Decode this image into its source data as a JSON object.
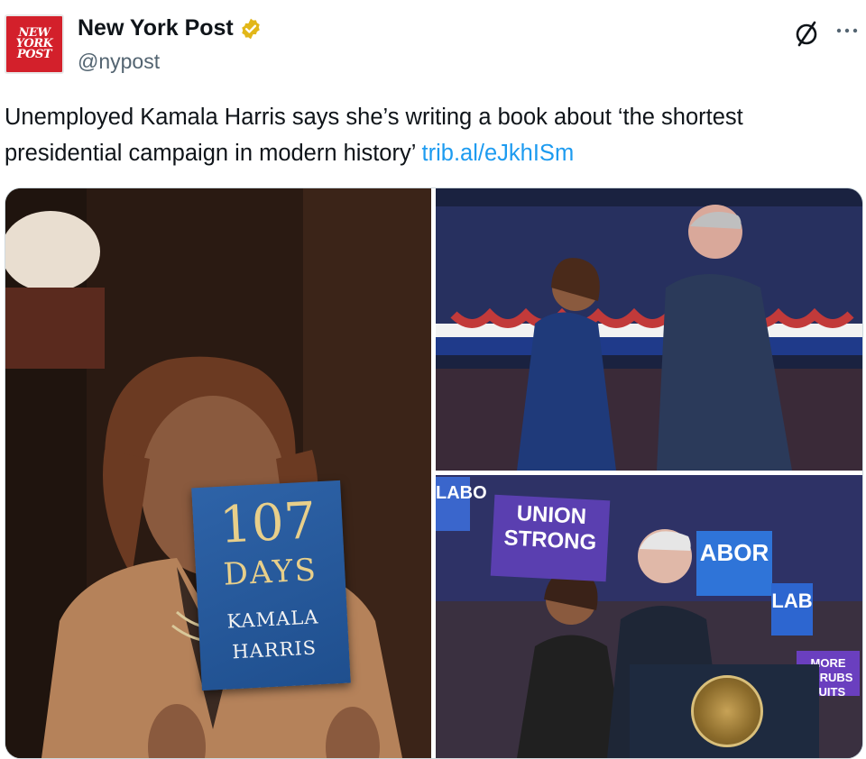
{
  "account": {
    "avatar_lines": [
      "NEW",
      "YORK",
      "POST"
    ],
    "name": "New York Post",
    "handle": "@nypost",
    "verified_badge": "gold-verified-badge",
    "colors": {
      "brand_red": "#d3202b",
      "gold": "#e2b719",
      "link": "#1d9bf0"
    }
  },
  "actions": {
    "grok_icon": "slashed-circle-icon",
    "more_icon": "ellipsis-icon"
  },
  "tweet": {
    "text": "Unemployed Kamala Harris says she’s writing a book about ‘the shortest presidential campaign in modern history’",
    "link": "trib.al/eJkhISm"
  },
  "media": {
    "photo1": {
      "book_number": "107",
      "book_word": "DAYS",
      "book_author_1": "KAMALA",
      "book_author_2": "HARRIS"
    },
    "photo3": {
      "sign_union": "UNION STRONG",
      "sign_labor": "ABOR",
      "sign_lab_left": "LABO",
      "sign_lab_right": "LAB",
      "sign_suits": "MORE SCRUBS SUITS"
    }
  }
}
